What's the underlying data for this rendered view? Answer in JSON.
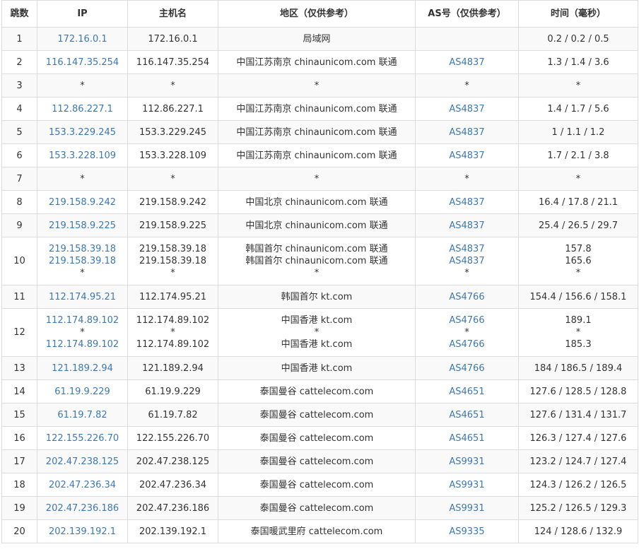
{
  "headers": [
    "跳数",
    "IP",
    "主机名",
    "地区（仅供参考）",
    "AS号（仅供参考）",
    "时间（毫秒）"
  ],
  "rows": [
    {
      "hop": "1",
      "ip": [
        "172.16.0.1"
      ],
      "host": [
        "172.16.0.1"
      ],
      "region": [
        "局域网"
      ],
      "as": [
        ""
      ],
      "time": [
        "0.2 / 0.2 / 0.5"
      ]
    },
    {
      "hop": "2",
      "ip": [
        "116.147.35.254"
      ],
      "host": [
        "116.147.35.254"
      ],
      "region": [
        "中国江苏南京 chinaunicom.com 联通"
      ],
      "as": [
        "AS4837"
      ],
      "time": [
        "1.3 / 1.4 / 3.6"
      ]
    },
    {
      "hop": "3",
      "ip": [
        "*"
      ],
      "host": [
        "*"
      ],
      "region": [
        "*"
      ],
      "as": [
        "*"
      ],
      "time": [
        "*"
      ]
    },
    {
      "hop": "4",
      "ip": [
        "112.86.227.1"
      ],
      "host": [
        "112.86.227.1"
      ],
      "region": [
        "中国江苏南京 chinaunicom.com 联通"
      ],
      "as": [
        "AS4837"
      ],
      "time": [
        "1.4 / 1.7 / 5.6"
      ]
    },
    {
      "hop": "5",
      "ip": [
        "153.3.229.245"
      ],
      "host": [
        "153.3.229.245"
      ],
      "region": [
        "中国江苏南京 chinaunicom.com 联通"
      ],
      "as": [
        "AS4837"
      ],
      "time": [
        "1 / 1.1 / 1.2"
      ]
    },
    {
      "hop": "6",
      "ip": [
        "153.3.228.109"
      ],
      "host": [
        "153.3.228.109"
      ],
      "region": [
        "中国江苏南京 chinaunicom.com 联通"
      ],
      "as": [
        "AS4837"
      ],
      "time": [
        "1.7 / 2.1 / 3.8"
      ]
    },
    {
      "hop": "7",
      "ip": [
        "*"
      ],
      "host": [
        "*"
      ],
      "region": [
        "*"
      ],
      "as": [
        "*"
      ],
      "time": [
        "*"
      ]
    },
    {
      "hop": "8",
      "ip": [
        "219.158.9.242"
      ],
      "host": [
        "219.158.9.242"
      ],
      "region": [
        "中国北京 chinaunicom.com 联通"
      ],
      "as": [
        "AS4837"
      ],
      "time": [
        "16.4 / 17.8 / 21.1"
      ]
    },
    {
      "hop": "9",
      "ip": [
        "219.158.9.225"
      ],
      "host": [
        "219.158.9.225"
      ],
      "region": [
        "中国北京 chinaunicom.com 联通"
      ],
      "as": [
        "AS4837"
      ],
      "time": [
        "25.4 / 26.5 / 29.7"
      ]
    },
    {
      "hop": "10",
      "ip": [
        "219.158.39.18",
        "219.158.39.18",
        "*"
      ],
      "host": [
        "219.158.39.18",
        "219.158.39.18",
        "*"
      ],
      "region": [
        "韩国首尔 chinaunicom.com 联通",
        "韩国首尔 chinaunicom.com 联通",
        "*"
      ],
      "as": [
        "AS4837",
        "AS4837",
        "*"
      ],
      "time": [
        "157.8",
        "165.6",
        "*"
      ]
    },
    {
      "hop": "11",
      "ip": [
        "112.174.95.21"
      ],
      "host": [
        "112.174.95.21"
      ],
      "region": [
        "韩国首尔 kt.com"
      ],
      "as": [
        "AS4766"
      ],
      "time": [
        "154.4 / 156.6 / 158.1"
      ]
    },
    {
      "hop": "12",
      "ip": [
        "112.174.89.102",
        "*",
        "112.174.89.102"
      ],
      "host": [
        "112.174.89.102",
        "*",
        "112.174.89.102"
      ],
      "region": [
        "中国香港 kt.com",
        "*",
        "中国香港 kt.com"
      ],
      "as": [
        "AS4766",
        "*",
        "AS4766"
      ],
      "time": [
        "189.1",
        "*",
        "185.3"
      ]
    },
    {
      "hop": "13",
      "ip": [
        "121.189.2.94"
      ],
      "host": [
        "121.189.2.94"
      ],
      "region": [
        "中国香港 kt.com"
      ],
      "as": [
        "AS4766"
      ],
      "time": [
        "184 / 186.5 / 189.4"
      ]
    },
    {
      "hop": "14",
      "ip": [
        "61.19.9.229"
      ],
      "host": [
        "61.19.9.229"
      ],
      "region": [
        "泰国曼谷 cattelecom.com"
      ],
      "as": [
        "AS4651"
      ],
      "time": [
        "127.6 / 128.5 / 128.8"
      ]
    },
    {
      "hop": "15",
      "ip": [
        "61.19.7.82"
      ],
      "host": [
        "61.19.7.82"
      ],
      "region": [
        "泰国曼谷 cattelecom.com"
      ],
      "as": [
        "AS4651"
      ],
      "time": [
        "127.6 / 131.4 / 131.7"
      ]
    },
    {
      "hop": "16",
      "ip": [
        "122.155.226.70"
      ],
      "host": [
        "122.155.226.70"
      ],
      "region": [
        "泰国曼谷 cattelecom.com"
      ],
      "as": [
        "AS4651"
      ],
      "time": [
        "126.3 / 127.4 / 127.6"
      ]
    },
    {
      "hop": "17",
      "ip": [
        "202.47.238.125"
      ],
      "host": [
        "202.47.238.125"
      ],
      "region": [
        "泰国曼谷 cattelecom.com"
      ],
      "as": [
        "AS9931"
      ],
      "time": [
        "123.2 / 124.7 / 127.4"
      ]
    },
    {
      "hop": "18",
      "ip": [
        "202.47.236.34"
      ],
      "host": [
        "202.47.236.34"
      ],
      "region": [
        "泰国曼谷 cattelecom.com"
      ],
      "as": [
        "AS9931"
      ],
      "time": [
        "124.3 / 126.2 / 126.5"
      ]
    },
    {
      "hop": "19",
      "ip": [
        "202.47.236.186"
      ],
      "host": [
        "202.47.236.186"
      ],
      "region": [
        "泰国曼谷 cattelecom.com"
      ],
      "as": [
        "AS9931"
      ],
      "time": [
        "125.2 / 126.5 / 129.3"
      ]
    },
    {
      "hop": "20",
      "ip": [
        "202.139.192.1"
      ],
      "host": [
        "202.139.192.1"
      ],
      "region": [
        "泰国暖武里府 cattelecom.com"
      ],
      "as": [
        "AS9335"
      ],
      "time": [
        "124 / 128.6 / 132.9"
      ]
    }
  ],
  "colors": {
    "link": "#3c78b4",
    "text": "#333333",
    "border": "#dddddd",
    "stripe": "#f9f9f9"
  }
}
